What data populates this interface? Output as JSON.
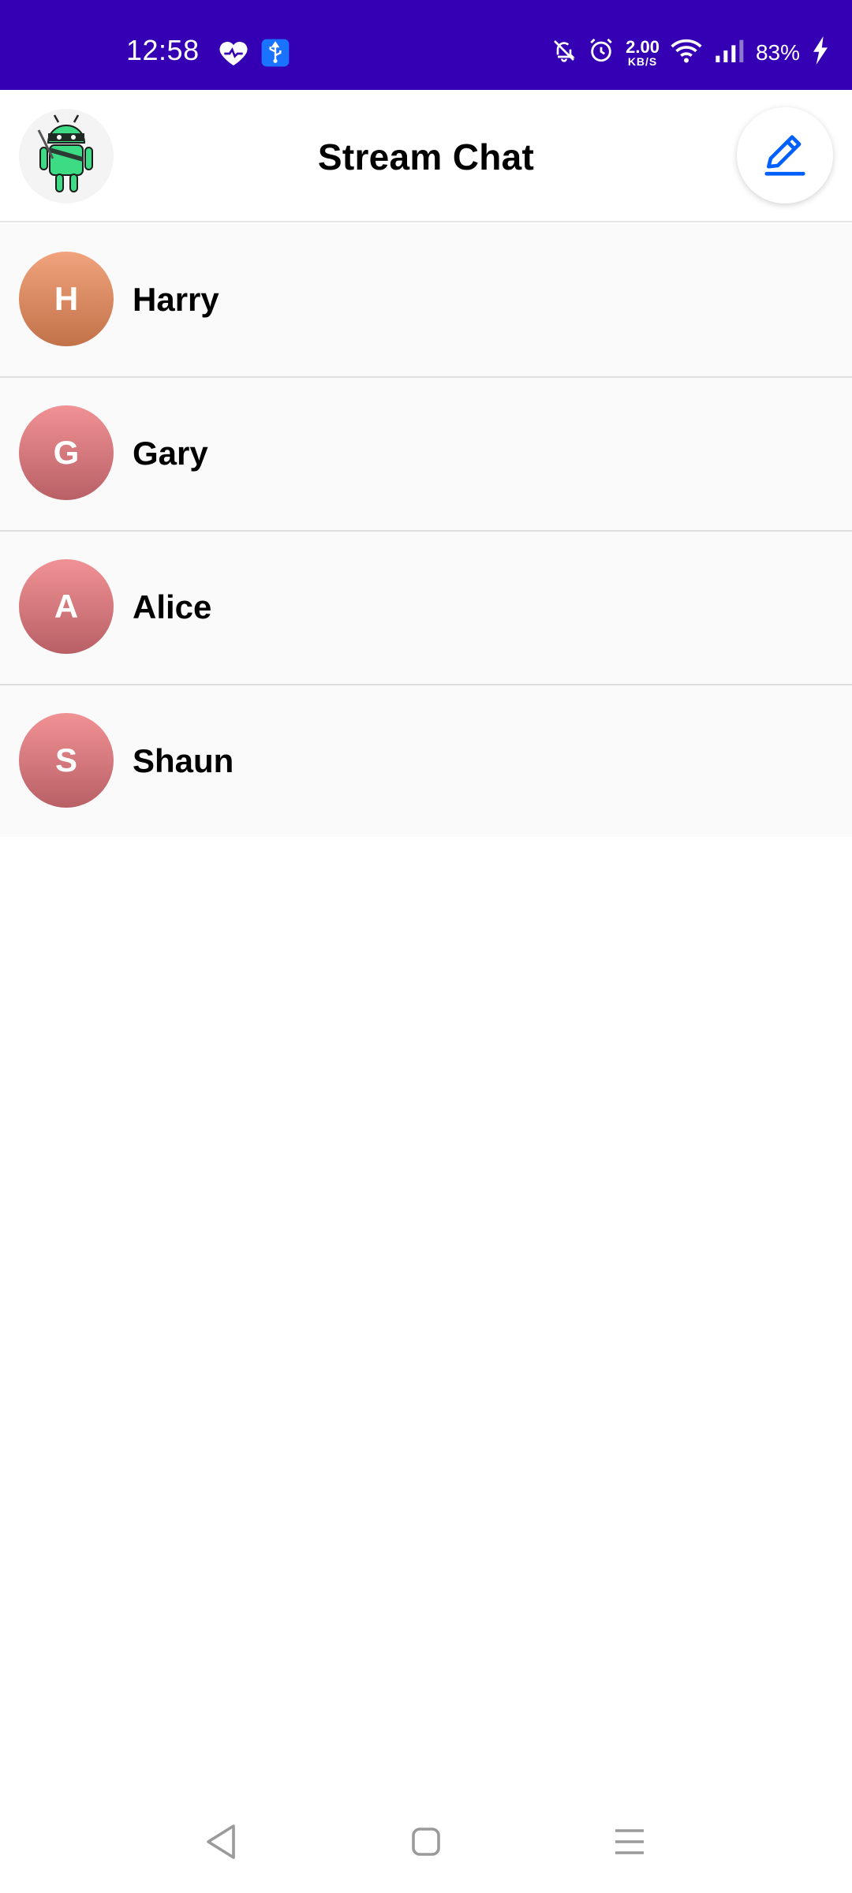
{
  "status_bar": {
    "time": "12:58",
    "speed_value": "2.00",
    "speed_unit": "KB/S",
    "battery_percent": "83%",
    "icons": [
      "heart-icon",
      "usb-icon",
      "mute-bell-icon",
      "alarm-icon",
      "wifi-icon",
      "signal-icon",
      "charging-icon"
    ]
  },
  "app_bar": {
    "title": "Stream Chat",
    "profile_icon": "android-mascot-avatar",
    "action_icon": "pencil-icon"
  },
  "channels": [
    {
      "initial": "H",
      "name": "Harry",
      "avatar_top": "#f0a37c",
      "avatar_bottom": "#c27249"
    },
    {
      "initial": "G",
      "name": "Gary",
      "avatar_top": "#f19295",
      "avatar_bottom": "#b86066"
    },
    {
      "initial": "A",
      "name": "Alice",
      "avatar_top": "#f19295",
      "avatar_bottom": "#b86066"
    },
    {
      "initial": "S",
      "name": "Shaun",
      "avatar_top": "#f19295",
      "avatar_bottom": "#b86066"
    }
  ],
  "nav_bar": {
    "icons": [
      "back-triangle-icon",
      "home-square-icon",
      "menu-lines-icon"
    ]
  },
  "colors": {
    "status_bar_bg": "#3500b3",
    "accent_blue": "#005fff"
  }
}
